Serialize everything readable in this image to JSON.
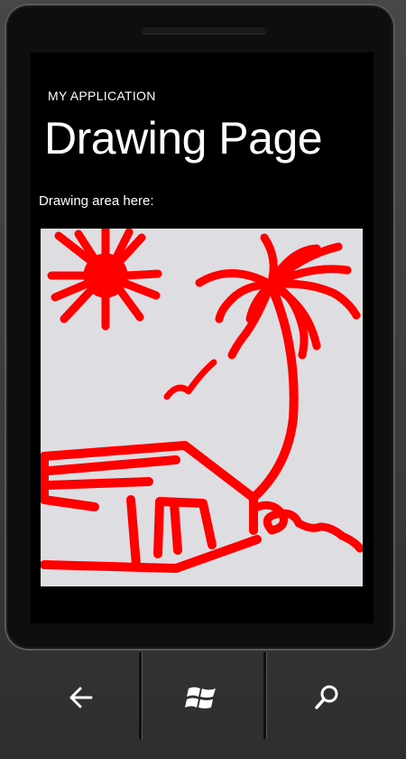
{
  "app": {
    "app_title": "MY APPLICATION",
    "page_title": "Drawing Page",
    "area_label": "Drawing area here:"
  },
  "drawing": {
    "ink_color": "#ff0000",
    "canvas_color": "#dedee2"
  },
  "nav": {
    "back": "back-arrow-icon",
    "start": "windows-logo-icon",
    "search": "search-icon"
  }
}
